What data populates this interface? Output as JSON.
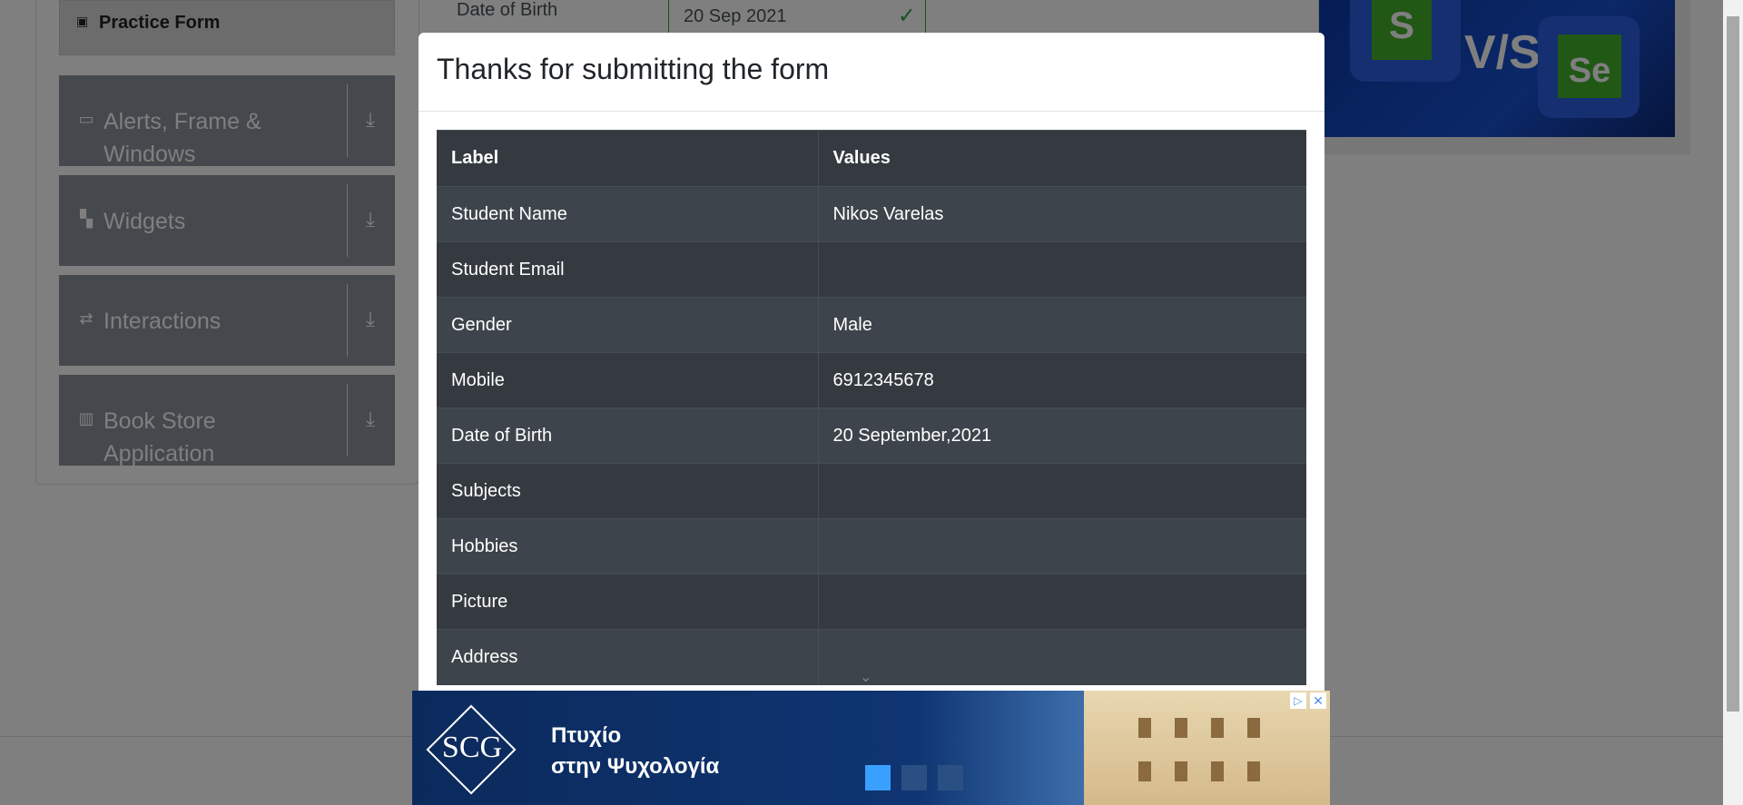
{
  "sidebar": {
    "practice_form": "Practice Form",
    "groups": [
      {
        "label": "Alerts, Frame & Windows",
        "icon": "window-icon"
      },
      {
        "label": "Widgets",
        "icon": "widgets-icon"
      },
      {
        "label": "Interactions",
        "icon": "interactions-icon"
      },
      {
        "label": "Book Store Application",
        "icon": "books-icon"
      }
    ]
  },
  "form": {
    "dob_label": "Date of Birth",
    "dob_value": "20 Sep 2021"
  },
  "modal": {
    "title": "Thanks for submitting the form",
    "headers": [
      "Label",
      "Values"
    ],
    "rows": [
      {
        "label": "Student Name",
        "value": "Nikos Varelas"
      },
      {
        "label": "Student Email",
        "value": ""
      },
      {
        "label": "Gender",
        "value": "Male"
      },
      {
        "label": "Mobile",
        "value": "6912345678"
      },
      {
        "label": "Date of Birth",
        "value": "20 September,2021"
      },
      {
        "label": "Subjects",
        "value": ""
      },
      {
        "label": "Hobbies",
        "value": ""
      },
      {
        "label": "Picture",
        "value": ""
      },
      {
        "label": "Address",
        "value": ""
      }
    ]
  },
  "bottom_ad": {
    "logo": "SCG",
    "line1": "Πτυχίο",
    "line2": "στην Ψυχολογία"
  },
  "colors": {
    "table_dark": "#343a40",
    "table_odd": "#3e444b",
    "accent_green": "#28a745",
    "sidebar_group": "#8a9198"
  }
}
